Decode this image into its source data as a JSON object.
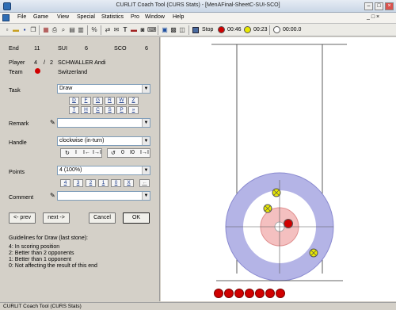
{
  "window": {
    "title": "CURLIT Coach Tool (CURS Stats) - [MenAFinal-SheetC-SUI-SCO]"
  },
  "menu": [
    "File",
    "Game",
    "View",
    "Special",
    "Statistics",
    "Pro",
    "Window",
    "Help"
  ],
  "toolbar": {
    "stop_label": "Stop",
    "red_time": "00:46",
    "yellow_time": "00:23",
    "clock_time": "00:00.0"
  },
  "header": {
    "end_label": "End",
    "end_value": "11",
    "team1": "SUI",
    "score1": "6",
    "team2": "SCO",
    "score2": "6",
    "player_label": "Player",
    "player_num": "4",
    "player_sep": "/",
    "player_total": "2",
    "player_name": "SCHWALLER Andi",
    "team_label": "Team",
    "team_name": "Switzerland"
  },
  "task": {
    "label": "Task",
    "value": "Draw",
    "keys": [
      "D",
      "F",
      "G",
      "R",
      "W",
      "Z",
      "T",
      "H",
      "C",
      "S",
      "P",
      "»"
    ]
  },
  "remark": {
    "label": "Remark",
    "value": ""
  },
  "handle": {
    "label": "Handle",
    "value": "clockwise (in-turn)",
    "keys_a": [
      "↻",
      "I",
      "I←",
      "I→I"
    ],
    "keys_b": [
      "↺",
      "0",
      "I0",
      "I→I"
    ]
  },
  "points": {
    "label": "Points",
    "value": "4 (100%)",
    "keys": [
      "4",
      "3",
      "2",
      "1",
      "0",
      "X",
      "←"
    ]
  },
  "comment": {
    "label": "Comment",
    "value": ""
  },
  "buttons": {
    "prev": "<- prev",
    "next": "next ->",
    "cancel": "Cancel",
    "ok": "OK"
  },
  "guidelines": {
    "title": "Guidelines for  Draw (last stone):",
    "lines": [
      "4: In scoring position",
      "2: Better than 2 opponents",
      "1: Better than 1 opponent",
      "0: Not affecting the result of this end"
    ]
  },
  "sheet": {
    "red_remaining": 7,
    "red_in_house": 1,
    "yellow_in_house": 3
  },
  "colors": {
    "red": "#d00000",
    "yellow": "#e8e800",
    "house_outer": "#b4b4e6",
    "house_inner": "#f4c0c0"
  },
  "status": {
    "text": "CURLIT Coach Tool (CURS Stats)"
  }
}
